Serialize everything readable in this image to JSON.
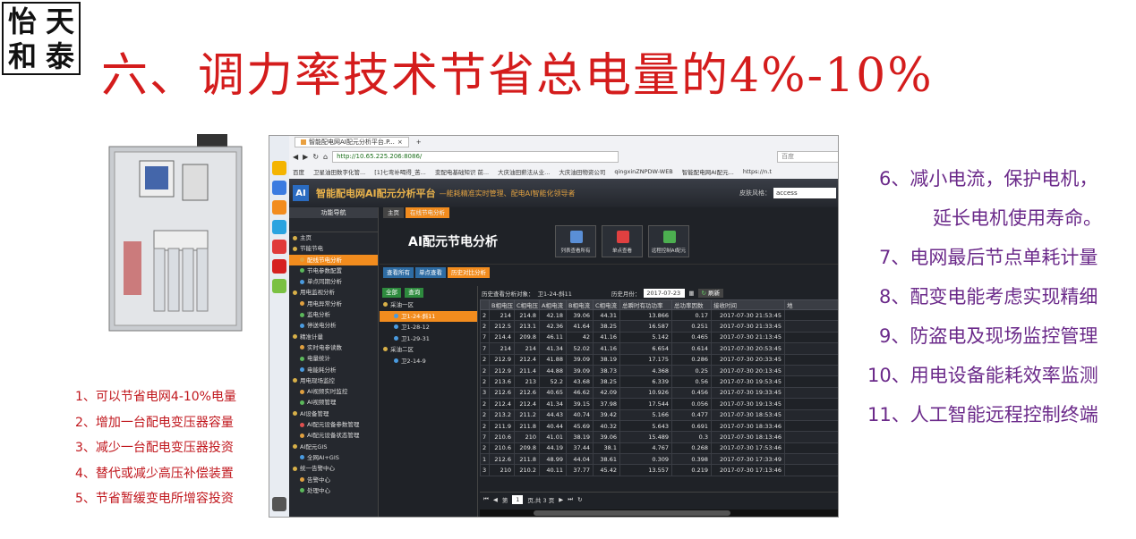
{
  "logo_chars": [
    "怡",
    "天",
    "和",
    "泰"
  ],
  "title": "六、调力率技术节省总电量的4%-10%",
  "left_list": [
    "1、可以节省电网4-10%电量",
    "2、增加一台配电变压器容量",
    "3、减少一台配电变压器投资",
    "4、替代或减少高压补偿装置",
    "5、节省暂缓变电所增容投资"
  ],
  "right_list": [
    "6、减小电流，保护电机，",
    "延长电机使用寿命。",
    "7、电网最后节点单耗计量",
    "8、配变电能考虑实现精细",
    "9、防盗电及现场监控管理",
    "10、用电设备能耗效率监测",
    "11、人工智能远程控制终端"
  ],
  "browser": {
    "tab_title": "智能配电网AI配元分析平台.P...",
    "url": "http://10.65.225.206:8086/",
    "search_placeholder": "百度",
    "bookmarks": [
      "百度",
      "卫星油田数字化管...",
      "[1]七弯补喝得_苦...",
      "变配电基础知识 前...",
      "大庆油田薪法从业...",
      "大庆油田物资公司",
      "qingxinZNPDW-WEB",
      "智能配电网AI配元...",
      "https://n.t"
    ]
  },
  "app": {
    "name": "智能配电网AI配元分析平台",
    "slogan": "—能耗精准实时管理、配电AI智能化领导者",
    "skin_label": "皮肤风格：",
    "skin_value": "access",
    "nav_title": "功能导航",
    "nav_items": [
      {
        "label": "主页",
        "level": 0
      },
      {
        "label": "节能节电",
        "level": 0
      },
      {
        "label": "配线节电分析",
        "level": 1,
        "selected": true
      },
      {
        "label": "节电参数配置",
        "level": 1
      },
      {
        "label": "单点同期分析",
        "level": 1
      },
      {
        "label": "用电监视分析",
        "level": 0
      },
      {
        "label": "用电异常分析",
        "level": 1
      },
      {
        "label": "监电分析",
        "level": 1
      },
      {
        "label": "停送电分析",
        "level": 1
      },
      {
        "label": "精准计量",
        "level": 0
      },
      {
        "label": "实时电参读数",
        "level": 1
      },
      {
        "label": "电量统计",
        "level": 1
      },
      {
        "label": "电能耗分析",
        "level": 1
      },
      {
        "label": "用电现场监控",
        "level": 0
      },
      {
        "label": "AI视频实时监控",
        "level": 1
      },
      {
        "label": "AI视频管理",
        "level": 1
      },
      {
        "label": "AI设备管理",
        "level": 0
      },
      {
        "label": "AI配元设备参数管理",
        "level": 1
      },
      {
        "label": "AI配元设备状态管理",
        "level": 1
      },
      {
        "label": "AI配元GIS",
        "level": 0
      },
      {
        "label": "全网AI+GIS",
        "level": 1
      },
      {
        "label": "统一告警中心",
        "level": 0
      },
      {
        "label": "告警中心",
        "level": 1
      },
      {
        "label": "处理中心",
        "level": 1
      }
    ],
    "tabs": [
      "主页",
      "在线节电分析"
    ],
    "hero_title": "AI配元节电分析",
    "hero_buttons": [
      "列表查看所有",
      "单点查看",
      "远程控制AI配元"
    ],
    "sub_tabs": [
      "查看所有",
      "单点查看",
      "历史对比分析"
    ],
    "tree_buttons": [
      "全部",
      "查询"
    ],
    "tree": [
      {
        "label": "采油一区",
        "level": 0
      },
      {
        "label": "卫1-24-斜11",
        "level": 1,
        "selected": true
      },
      {
        "label": "卫1-28-12",
        "level": 1
      },
      {
        "label": "卫1-29-31",
        "level": 1
      },
      {
        "label": "采油二区",
        "level": 0
      },
      {
        "label": "卫2-14-9",
        "level": 1
      }
    ],
    "grid_target_label": "历史查看分析对象：",
    "grid_target": "卫1-24-斜11",
    "grid_month_label": "历史月份：",
    "grid_month": "2017-07-23",
    "refresh": "刷新",
    "columns": [
      "",
      "B相电压",
      "C相电压",
      "A相电流",
      "B相电流",
      "C相电流",
      "总瞬时有功功率",
      "总功率因数",
      "接收时间",
      "地"
    ],
    "rows": [
      [
        "2",
        "214",
        "214.8",
        "42.18",
        "39.06",
        "44.31",
        "13.866",
        "0.17",
        "2017-07-30 21:53:45"
      ],
      [
        "2",
        "212.5",
        "213.1",
        "42.36",
        "41.64",
        "38.25",
        "16.587",
        "0.251",
        "2017-07-30 21:33:45"
      ],
      [
        "7",
        "214.4",
        "209.8",
        "46.11",
        "42",
        "41.16",
        "5.142",
        "0.465",
        "2017-07-30 21:13:45"
      ],
      [
        "7",
        "214",
        "214",
        "41.34",
        "52.02",
        "41.16",
        "6.654",
        "0.614",
        "2017-07-30 20:53:45"
      ],
      [
        "2",
        "212.9",
        "212.4",
        "41.88",
        "39.09",
        "38.19",
        "17.175",
        "0.286",
        "2017-07-30 20:33:45"
      ],
      [
        "2",
        "212.9",
        "211.4",
        "44.88",
        "39.09",
        "38.73",
        "4.368",
        "0.25",
        "2017-07-30 20:13:45"
      ],
      [
        "2",
        "213.6",
        "213",
        "52.2",
        "43.68",
        "38.25",
        "6.339",
        "0.56",
        "2017-07-30 19:53:45"
      ],
      [
        "3",
        "212.6",
        "212.6",
        "40.65",
        "46.62",
        "42.09",
        "10.926",
        "0.456",
        "2017-07-30 19:33:45"
      ],
      [
        "2",
        "212.4",
        "212.4",
        "41.34",
        "39.15",
        "37.98",
        "17.544",
        "0.056",
        "2017-07-30 19:13:45"
      ],
      [
        "2",
        "213.2",
        "211.2",
        "44.43",
        "40.74",
        "39.42",
        "5.166",
        "0.477",
        "2017-07-30 18:53:45"
      ],
      [
        "2",
        "211.9",
        "211.8",
        "40.44",
        "45.69",
        "40.32",
        "5.643",
        "0.691",
        "2017-07-30 18:33:46"
      ],
      [
        "7",
        "210.6",
        "210",
        "41.01",
        "38.19",
        "39.06",
        "15.489",
        "0.3",
        "2017-07-30 18:13:46"
      ],
      [
        "2",
        "210.6",
        "209.8",
        "44.19",
        "37.44",
        "38.1",
        "4.767",
        "0.268",
        "2017-07-30 17:53:46"
      ],
      [
        "1",
        "212.6",
        "211.8",
        "48.99",
        "44.04",
        "38.61",
        "0.309",
        "0.398",
        "2017-07-30 17:33:49"
      ],
      [
        "3",
        "210",
        "210.2",
        "40.11",
        "37.77",
        "45.42",
        "13.557",
        "0.219",
        "2017-07-30 17:13:46"
      ]
    ],
    "pager": {
      "page_label": "第",
      "page": "1",
      "of_label": "页,共 3 页"
    }
  }
}
